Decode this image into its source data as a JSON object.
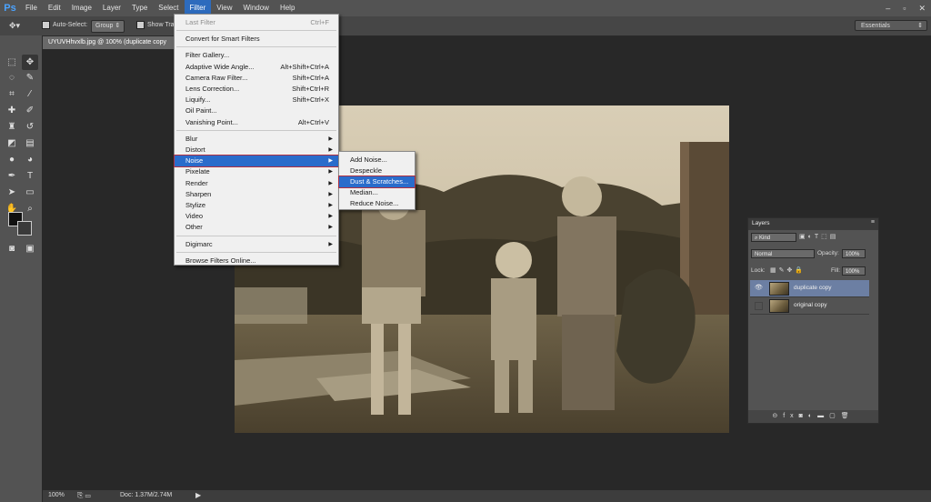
{
  "app": {
    "logo": "Ps"
  },
  "menubar": {
    "items": [
      "File",
      "Edit",
      "Image",
      "Layer",
      "Type",
      "Select",
      "Filter",
      "View",
      "Window",
      "Help"
    ],
    "active": "Filter",
    "window_controls": [
      "–",
      "▫",
      "✕"
    ]
  },
  "options_bar": {
    "auto_select_label": "Auto-Select:",
    "auto_select_value": "Group",
    "show_transform_label": "Show Tran",
    "workspace": "Essentials"
  },
  "document": {
    "tab_title": "UYUVHhvxlb.jpg @ 100% (duplicate copy",
    "zoom": "100%",
    "doc_info": "Doc: 1.37M/2.74M"
  },
  "filter_menu": {
    "items": [
      {
        "label": "Last Filter",
        "shortcut": "Ctrl+F",
        "disabled": true
      },
      {
        "sep": true
      },
      {
        "label": "Convert for Smart Filters"
      },
      {
        "sep": true
      },
      {
        "label": "Filter Gallery..."
      },
      {
        "label": "Adaptive Wide Angle...",
        "shortcut": "Alt+Shift+Ctrl+A"
      },
      {
        "label": "Camera Raw Filter...",
        "shortcut": "Shift+Ctrl+A"
      },
      {
        "label": "Lens Correction...",
        "shortcut": "Shift+Ctrl+R"
      },
      {
        "label": "Liquify...",
        "shortcut": "Shift+Ctrl+X"
      },
      {
        "label": "Oil Paint..."
      },
      {
        "label": "Vanishing Point...",
        "shortcut": "Alt+Ctrl+V"
      },
      {
        "sep": true
      },
      {
        "label": "Blur",
        "submenu": true
      },
      {
        "label": "Distort",
        "submenu": true
      },
      {
        "label": "Noise",
        "submenu": true,
        "highlighted": true
      },
      {
        "label": "Pixelate",
        "submenu": true
      },
      {
        "label": "Render",
        "submenu": true
      },
      {
        "label": "Sharpen",
        "submenu": true
      },
      {
        "label": "Stylize",
        "submenu": true
      },
      {
        "label": "Video",
        "submenu": true
      },
      {
        "label": "Other",
        "submenu": true
      },
      {
        "sep": true
      },
      {
        "label": "Digimarc",
        "submenu": true
      },
      {
        "sep": true
      },
      {
        "label": "Browse Filters Online..."
      }
    ]
  },
  "noise_submenu": {
    "items": [
      {
        "label": "Add Noise..."
      },
      {
        "label": "Despeckle"
      },
      {
        "label": "Dust & Scratches...",
        "highlighted": true
      },
      {
        "label": "Median..."
      },
      {
        "label": "Reduce Noise..."
      }
    ]
  },
  "layers_panel": {
    "title": "Layers",
    "kind_filter": "Kind",
    "blend_mode": "Normal",
    "opacity_label": "Opacity:",
    "opacity_value": "100%",
    "lock_label": "Lock:",
    "fill_label": "Fill:",
    "fill_value": "100%",
    "layers": [
      {
        "name": "duplicate copy",
        "visible": true,
        "selected": true
      },
      {
        "name": "original copy",
        "visible": false,
        "selected": false
      }
    ]
  }
}
